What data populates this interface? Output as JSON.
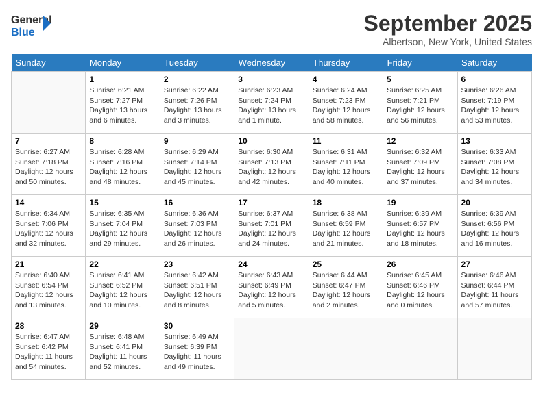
{
  "header": {
    "logo_line1": "General",
    "logo_line2": "Blue",
    "month_title": "September 2025",
    "location": "Albertson, New York, United States"
  },
  "days_of_week": [
    "Sunday",
    "Monday",
    "Tuesday",
    "Wednesday",
    "Thursday",
    "Friday",
    "Saturday"
  ],
  "weeks": [
    [
      {
        "day": "",
        "info": ""
      },
      {
        "day": "1",
        "info": "Sunrise: 6:21 AM\nSunset: 7:27 PM\nDaylight: 13 hours\nand 6 minutes."
      },
      {
        "day": "2",
        "info": "Sunrise: 6:22 AM\nSunset: 7:26 PM\nDaylight: 13 hours\nand 3 minutes."
      },
      {
        "day": "3",
        "info": "Sunrise: 6:23 AM\nSunset: 7:24 PM\nDaylight: 13 hours\nand 1 minute."
      },
      {
        "day": "4",
        "info": "Sunrise: 6:24 AM\nSunset: 7:23 PM\nDaylight: 12 hours\nand 58 minutes."
      },
      {
        "day": "5",
        "info": "Sunrise: 6:25 AM\nSunset: 7:21 PM\nDaylight: 12 hours\nand 56 minutes."
      },
      {
        "day": "6",
        "info": "Sunrise: 6:26 AM\nSunset: 7:19 PM\nDaylight: 12 hours\nand 53 minutes."
      }
    ],
    [
      {
        "day": "7",
        "info": "Sunrise: 6:27 AM\nSunset: 7:18 PM\nDaylight: 12 hours\nand 50 minutes."
      },
      {
        "day": "8",
        "info": "Sunrise: 6:28 AM\nSunset: 7:16 PM\nDaylight: 12 hours\nand 48 minutes."
      },
      {
        "day": "9",
        "info": "Sunrise: 6:29 AM\nSunset: 7:14 PM\nDaylight: 12 hours\nand 45 minutes."
      },
      {
        "day": "10",
        "info": "Sunrise: 6:30 AM\nSunset: 7:13 PM\nDaylight: 12 hours\nand 42 minutes."
      },
      {
        "day": "11",
        "info": "Sunrise: 6:31 AM\nSunset: 7:11 PM\nDaylight: 12 hours\nand 40 minutes."
      },
      {
        "day": "12",
        "info": "Sunrise: 6:32 AM\nSunset: 7:09 PM\nDaylight: 12 hours\nand 37 minutes."
      },
      {
        "day": "13",
        "info": "Sunrise: 6:33 AM\nSunset: 7:08 PM\nDaylight: 12 hours\nand 34 minutes."
      }
    ],
    [
      {
        "day": "14",
        "info": "Sunrise: 6:34 AM\nSunset: 7:06 PM\nDaylight: 12 hours\nand 32 minutes."
      },
      {
        "day": "15",
        "info": "Sunrise: 6:35 AM\nSunset: 7:04 PM\nDaylight: 12 hours\nand 29 minutes."
      },
      {
        "day": "16",
        "info": "Sunrise: 6:36 AM\nSunset: 7:03 PM\nDaylight: 12 hours\nand 26 minutes."
      },
      {
        "day": "17",
        "info": "Sunrise: 6:37 AM\nSunset: 7:01 PM\nDaylight: 12 hours\nand 24 minutes."
      },
      {
        "day": "18",
        "info": "Sunrise: 6:38 AM\nSunset: 6:59 PM\nDaylight: 12 hours\nand 21 minutes."
      },
      {
        "day": "19",
        "info": "Sunrise: 6:39 AM\nSunset: 6:57 PM\nDaylight: 12 hours\nand 18 minutes."
      },
      {
        "day": "20",
        "info": "Sunrise: 6:39 AM\nSunset: 6:56 PM\nDaylight: 12 hours\nand 16 minutes."
      }
    ],
    [
      {
        "day": "21",
        "info": "Sunrise: 6:40 AM\nSunset: 6:54 PM\nDaylight: 12 hours\nand 13 minutes."
      },
      {
        "day": "22",
        "info": "Sunrise: 6:41 AM\nSunset: 6:52 PM\nDaylight: 12 hours\nand 10 minutes."
      },
      {
        "day": "23",
        "info": "Sunrise: 6:42 AM\nSunset: 6:51 PM\nDaylight: 12 hours\nand 8 minutes."
      },
      {
        "day": "24",
        "info": "Sunrise: 6:43 AM\nSunset: 6:49 PM\nDaylight: 12 hours\nand 5 minutes."
      },
      {
        "day": "25",
        "info": "Sunrise: 6:44 AM\nSunset: 6:47 PM\nDaylight: 12 hours\nand 2 minutes."
      },
      {
        "day": "26",
        "info": "Sunrise: 6:45 AM\nSunset: 6:46 PM\nDaylight: 12 hours\nand 0 minutes."
      },
      {
        "day": "27",
        "info": "Sunrise: 6:46 AM\nSunset: 6:44 PM\nDaylight: 11 hours\nand 57 minutes."
      }
    ],
    [
      {
        "day": "28",
        "info": "Sunrise: 6:47 AM\nSunset: 6:42 PM\nDaylight: 11 hours\nand 54 minutes."
      },
      {
        "day": "29",
        "info": "Sunrise: 6:48 AM\nSunset: 6:41 PM\nDaylight: 11 hours\nand 52 minutes."
      },
      {
        "day": "30",
        "info": "Sunrise: 6:49 AM\nSunset: 6:39 PM\nDaylight: 11 hours\nand 49 minutes."
      },
      {
        "day": "",
        "info": ""
      },
      {
        "day": "",
        "info": ""
      },
      {
        "day": "",
        "info": ""
      },
      {
        "day": "",
        "info": ""
      }
    ]
  ]
}
